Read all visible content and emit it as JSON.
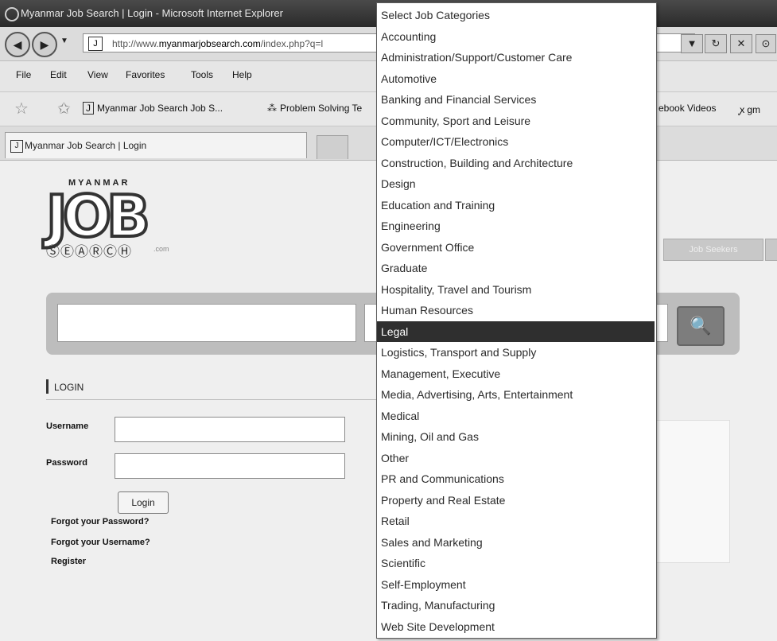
{
  "browser": {
    "window_title": "Myanmar Job Search | Login - Microsoft Internet Explorer",
    "address": {
      "prefix": "http://www.",
      "domain": "myanmarjobsearch.com",
      "suffix": "/index.php?q=l"
    },
    "menu": [
      "File",
      "Edit",
      "View",
      "Favorites",
      "Tools",
      "Help"
    ],
    "favorites": [
      "Myanmar Job Search Job S...",
      "Problem Solving Te",
      "ebook Videos",
      "gm"
    ],
    "tab_title": "Myanmar Job Search | Login",
    "icons": {
      "page": "J",
      "back": "◀",
      "forward": "▶",
      "dropdown": "▼",
      "refresh": "↻",
      "stop": "✕",
      "search": "⊙",
      "star": "☆",
      "add_star": "✩",
      "slice": "⁂",
      "fav_icon": "ꭙ"
    }
  },
  "page": {
    "logo": {
      "top": "MYANMAR",
      "main": "JOB",
      "search": "ⓈⒺⒶⓇⒸⒽ",
      "suffix": ".com"
    },
    "jobseekers_button": "Job Seekers",
    "search_icon": "🔍",
    "login": {
      "heading": "LOGIN",
      "username_label": "Username",
      "password_label": "Password",
      "button": "Login",
      "forgot_password": "Forgot your Password?",
      "forgot_username": "Forgot your Username?",
      "register": "Register"
    }
  },
  "dropdown": {
    "selected_index": 15,
    "items": [
      "Select Job Categories",
      "Accounting",
      "Administration/Support/Customer Care",
      "Automotive",
      "Banking and Financial Services",
      "Community, Sport and Leisure",
      "Computer/ICT/Electronics",
      "Construction, Building and Architecture",
      "Design",
      "Education and Training",
      "Engineering",
      "Government Office",
      "Graduate",
      "Hospitality, Travel and Tourism",
      "Human Resources",
      "Legal",
      "Logistics, Transport and Supply",
      "Management, Executive",
      "Media, Advertising, Arts, Entertainment",
      "Medical",
      "Mining, Oil and Gas",
      "Other",
      "PR and Communications",
      "Property and Real Estate",
      "Retail",
      "Sales and Marketing",
      "Scientific",
      "Self-Employment",
      "Trading, Manufacturing",
      "Web Site Development"
    ]
  }
}
